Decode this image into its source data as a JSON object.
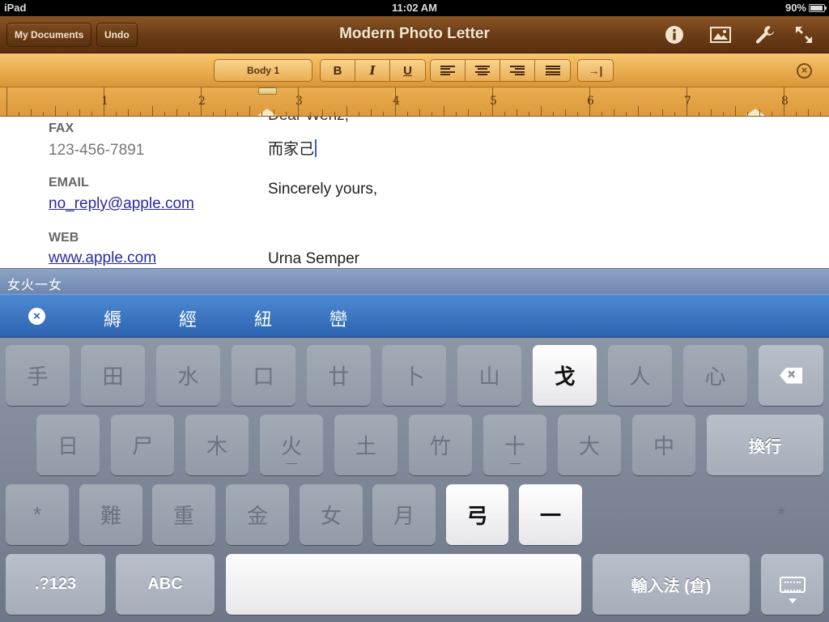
{
  "status_bar": {
    "carrier": "iPad",
    "time": "11:02 AM",
    "battery": "90%",
    "battery_level": 0.9
  },
  "toolbar": {
    "my_documents_label": "My Documents",
    "undo_label": "Undo",
    "title": "Modern Photo Letter",
    "icons": [
      "info-icon",
      "media-icon",
      "wrench-icon",
      "fullscreen-icon"
    ]
  },
  "format_bar": {
    "style_label": "Body 1",
    "bold_label": "B",
    "italic_label": "I",
    "underline_label": "U",
    "tab_label": "→|"
  },
  "ruler": {
    "numbers": [
      "1",
      "2",
      "3",
      "4",
      "5",
      "6",
      "7",
      "8"
    ]
  },
  "document": {
    "fax_label": "FAX",
    "fax_value": "123-456-7891",
    "email_label": "EMAIL",
    "email_value": "no_reply@apple.com",
    "web_label": "WEB",
    "web_value": "www.apple.com",
    "partial_line": "Dear Wenz,",
    "typed_text": "而家己",
    "closing": "Sincerely yours,",
    "signature": "Urna Semper"
  },
  "input_method": {
    "composing": "女火一女",
    "candidates": [
      "縟",
      "經",
      "紐",
      "巒"
    ]
  },
  "keyboard": {
    "row1": [
      "手",
      "田",
      "水",
      "口",
      "廿",
      "卜",
      "山",
      "戈",
      "人",
      "心"
    ],
    "row2": [
      "日",
      "尸",
      "木",
      "火",
      "土",
      "竹",
      "十",
      "大",
      "中"
    ],
    "row2_return": "換行",
    "row3": [
      "*",
      "難",
      "重",
      "金",
      "女",
      "月",
      "弓",
      "一",
      "*"
    ],
    "numbers_label": ".?123",
    "abc_label": "ABC",
    "ime_label": "輸入法 (倉)"
  }
}
